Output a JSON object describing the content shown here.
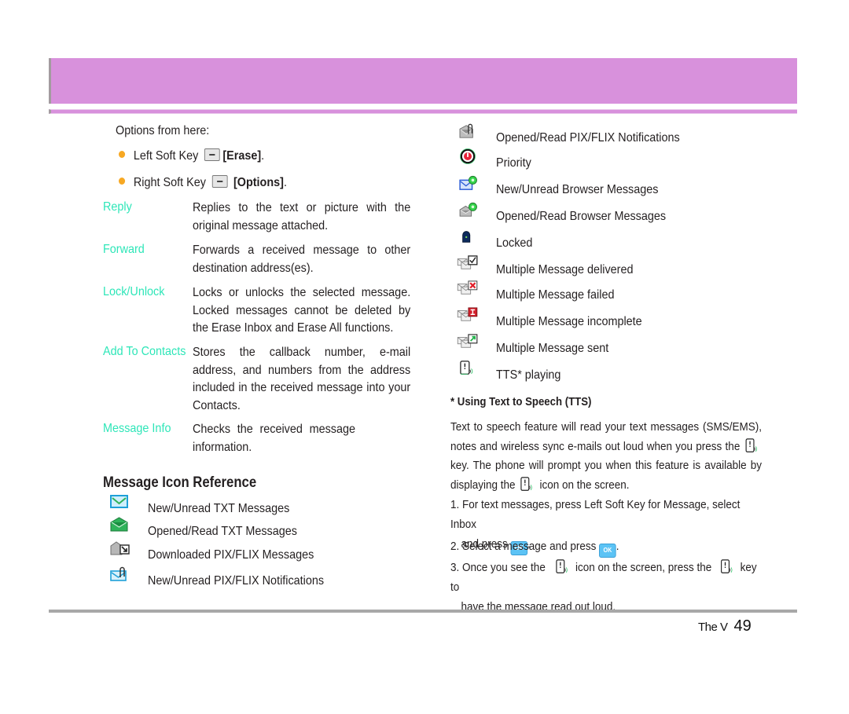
{
  "header": {
    "banner_color": "#d891dc"
  },
  "options": {
    "intro": "Options from here:",
    "bullets": [
      {
        "prefix": "Left Soft Key",
        "action": "[Erase]",
        "suffix": "."
      },
      {
        "prefix": "Right Soft Key",
        "action": "[Options]",
        "suffix": "."
      }
    ]
  },
  "definitions": [
    {
      "term": "Reply",
      "desc": "Replies to the text or picture with the original message attached."
    },
    {
      "term": "Forward",
      "desc": "Forwards a received message to other destination address(es)."
    },
    {
      "term": "Lock/Unlock",
      "desc": "Locks or unlocks the selected message. Locked messages cannot be deleted by the Erase Inbox and Erase All functions."
    },
    {
      "term": "Add To Contacts",
      "desc": "Stores the callback number, e-mail address, and numbers from the address included in the received message into your Contacts."
    },
    {
      "term": "Message Info",
      "desc": "Checks the received message information."
    }
  ],
  "icon_reference": {
    "title": "Message Icon Reference",
    "left_items": [
      {
        "icon": "new-unread-txt-icon",
        "label": "New/Unread TXT Messages"
      },
      {
        "icon": "opened-read-txt-icon",
        "label": "Opened/Read TXT Messages"
      },
      {
        "icon": "downloaded-pix-flix-icon",
        "label": "Downloaded PIX/FLIX Messages"
      },
      {
        "icon": "new-unread-pix-flix-notification-icon",
        "label": "New/Unread PIX/FLIX Notifications"
      }
    ],
    "right_items": [
      {
        "icon": "opened-read-pix-flix-notification-icon",
        "label": "Opened/Read PIX/FLIX Notifications"
      },
      {
        "icon": "priority-icon",
        "label": "Priority"
      },
      {
        "icon": "new-unread-browser-icon",
        "label": "New/Unread Browser Messages"
      },
      {
        "icon": "opened-read-browser-icon",
        "label": "Opened/Read Browser Messages"
      },
      {
        "icon": "locked-icon",
        "label": "Locked"
      },
      {
        "icon": "multiple-delivered-icon",
        "label": "Multiple Message delivered"
      },
      {
        "icon": "multiple-failed-icon",
        "label": "Multiple Message failed"
      },
      {
        "icon": "multiple-incomplete-icon",
        "label": "Multiple Message incomplete"
      },
      {
        "icon": "multiple-sent-icon",
        "label": "Multiple Message sent"
      },
      {
        "icon": "tts-playing-icon",
        "label": "TTS* playing"
      }
    ]
  },
  "tts": {
    "heading": "* Using Text to Speech (TTS)",
    "para_1": "Text to speech feature will read your text messages (SMS/EMS), notes and wireless sync e-mails out loud when you press the",
    "para_2": "key. The phone will prompt you when this feature is available by displaying the",
    "para_3": "icon on the screen.",
    "step1_a": "1. For text messages, press Left Soft Key for Message, select Inbox",
    "step1_b": "and press",
    "step2": "2. Select a message and press",
    "step3_a": "3. Once you see the",
    "step3_b": "icon on the screen, press the",
    "step3_c": "key to",
    "step3_d": "have the message read out loud.",
    "ok_label": "OK",
    "period": "."
  },
  "footer": {
    "brand": "The V",
    "page_number": "49"
  }
}
